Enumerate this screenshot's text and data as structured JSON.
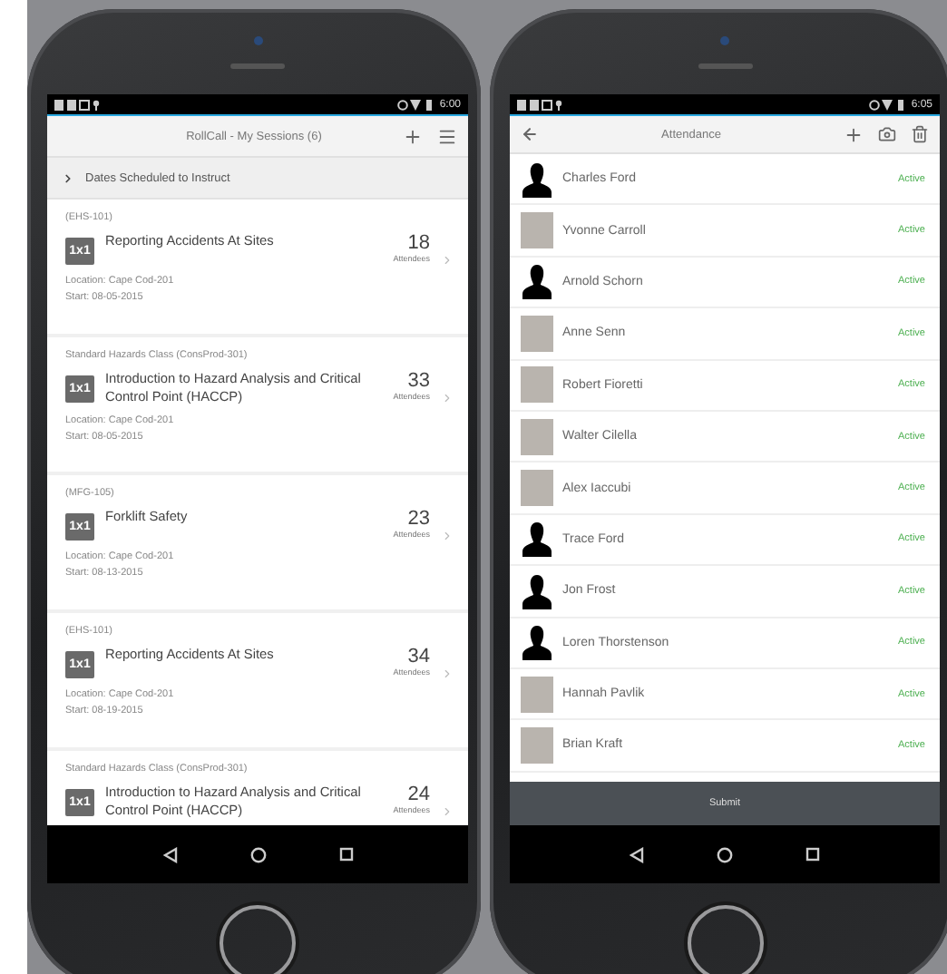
{
  "sessions_screen": {
    "status_time": "6:00",
    "title": "RollCall - My Sessions (6)",
    "section": "Dates Scheduled to Instruct",
    "sessions": [
      {
        "code": "(EHS-101)",
        "badge": "1x1",
        "title": "Reporting Accidents At Sites",
        "count": "18",
        "count_label": "Attendees",
        "location": "Location: Cape Cod-201",
        "start": "Start: 08-05-2015"
      },
      {
        "code": "Standard Hazards Class (ConsProd-301)",
        "badge": "1x1",
        "title": "Introduction to Hazard Analysis and Critical Control Point (HACCP)",
        "count": "33",
        "count_label": "Attendees",
        "location": "Location: Cape Cod-201",
        "start": "Start: 08-05-2015"
      },
      {
        "code": "(MFG-105)",
        "badge": "1x1",
        "title": "Forklift Safety",
        "count": "23",
        "count_label": "Attendees",
        "location": "Location: Cape Cod-201",
        "start": "Start: 08-13-2015"
      },
      {
        "code": "(EHS-101)",
        "badge": "1x1",
        "title": "Reporting Accidents At Sites",
        "count": "34",
        "count_label": "Attendees",
        "location": "Location: Cape Cod-201",
        "start": "Start: 08-19-2015"
      },
      {
        "code": "Standard Hazards Class (ConsProd-301)",
        "badge": "1x1",
        "title": "Introduction to Hazard Analysis and Critical Control Point (HACCP)",
        "count": "24",
        "count_label": "Attendees"
      }
    ]
  },
  "attendance_screen": {
    "status_time": "6:05",
    "title": "Attendance",
    "attendees": [
      {
        "name": "Charles Ford",
        "status": "Active",
        "kind": "silhouette"
      },
      {
        "name": "Yvonne Carroll",
        "status": "Active",
        "kind": "photo"
      },
      {
        "name": "Arnold Schorn",
        "status": "Active",
        "kind": "silhouette"
      },
      {
        "name": "Anne Senn",
        "status": "Active",
        "kind": "photo"
      },
      {
        "name": "Robert Fioretti",
        "status": "Active",
        "kind": "photo"
      },
      {
        "name": "Walter Cilella",
        "status": "Active",
        "kind": "photo"
      },
      {
        "name": "Alex Iaccubi",
        "status": "Active",
        "kind": "photo"
      },
      {
        "name": "Trace Ford",
        "status": "Active",
        "kind": "silhouette"
      },
      {
        "name": "Jon Frost",
        "status": "Active",
        "kind": "silhouette"
      },
      {
        "name": "Loren Thorstenson",
        "status": "Active",
        "kind": "silhouette"
      },
      {
        "name": "Hannah Pavlik",
        "status": "Active",
        "kind": "photo"
      },
      {
        "name": "Brian Kraft",
        "status": "Active",
        "kind": "photo"
      }
    ],
    "submit": "Submit"
  }
}
